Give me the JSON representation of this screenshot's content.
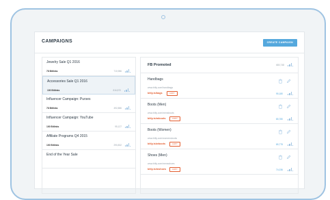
{
  "header": {
    "title": "CAMPAIGNS",
    "create_label": "CREATE CAMPAIGN"
  },
  "campaigns": [
    {
      "name": "Jewelry Sale Q1 2016",
      "clicks": "78 Bitlinks",
      "date": "710,986"
    },
    {
      "name": "Accessories Sale Q1 2016",
      "clicks": "100 Bitlinks",
      "date": "816,870"
    },
    {
      "name": "Influencer Campaign: Purses",
      "clicks": "78 Bitlinks",
      "date": "492,886"
    },
    {
      "name": "Influencer Campaign: YouTube",
      "clicks": "100 Bitlinks",
      "date": "95,127"
    },
    {
      "name": "Affiliate Programs Q4 2015",
      "clicks": "100 Bitlinks",
      "date": "290,832"
    },
    {
      "name": "End of the Year Sale",
      "clicks": "",
      "date": ""
    }
  ],
  "panel": {
    "title": "FB Promoted",
    "count": "680,748",
    "links": [
      {
        "name": "Handbags",
        "url": "www.bitly.com/handbags",
        "short": "bitly.is/bags",
        "copy": "COPY",
        "clicks": "95,180"
      },
      {
        "name": "Boots (Men)",
        "url": "www.bitly.com/mensboots",
        "short": "bitly.is/mboots",
        "copy": "COPY",
        "clicks": "85,780"
      },
      {
        "name": "Boots (Women)",
        "url": "www.bitly.com/womensboots",
        "short": "bitly.is/wboots",
        "copy": "COPY",
        "clicks": "85,775"
      },
      {
        "name": "Shoes (Men)",
        "url": "www.bitly.com/mensshoes",
        "short": "bitly.is/mshoes",
        "copy": "COPY",
        "clicks": "74,036"
      }
    ]
  },
  "colors": {
    "accent": "#55a8dd",
    "shortlink": "#e35d2f",
    "frame": "#9ec3e2"
  }
}
